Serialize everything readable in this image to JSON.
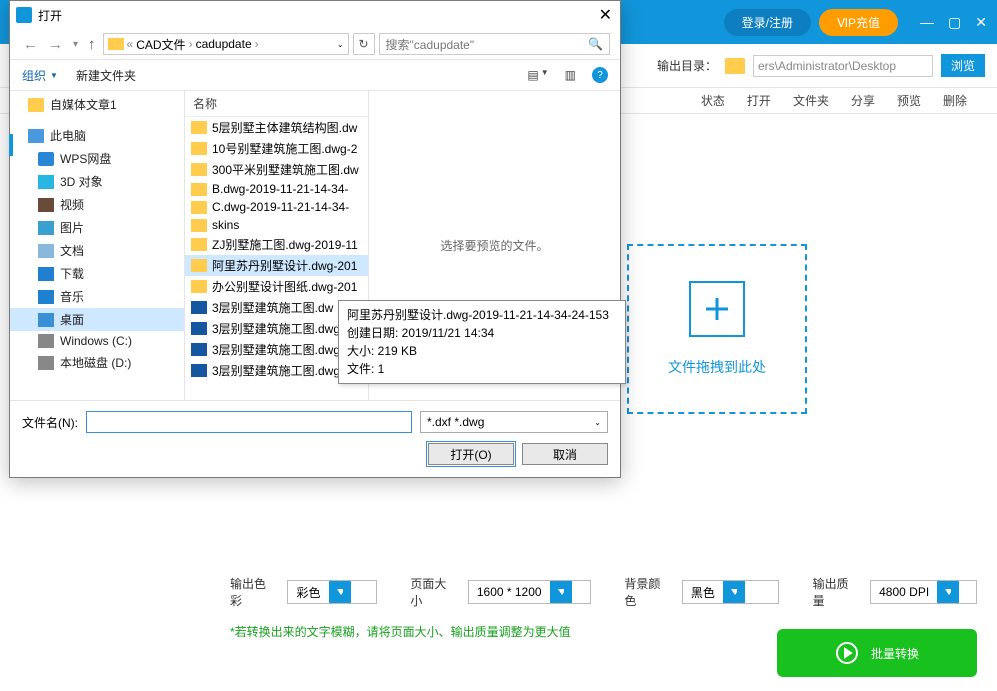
{
  "app": {
    "login": "登录/注册",
    "vip": "ⅥP充值",
    "outdir_label": "输出目录：",
    "outdir_path": "ers\\Administrator\\Desktop",
    "browse": "浏览",
    "cols": {
      "status": "状态",
      "open": "打开",
      "folder": "文件夹",
      "share": "分享",
      "preview": "预览",
      "delete": "删除"
    },
    "drop_text": "文件拖拽到此处",
    "footer": {
      "colorspace_label": "输出色彩",
      "colorspace_value": "彩色",
      "pagesize_label": "页面大小",
      "pagesize_value": "1600 * 1200",
      "bgcolor_label": "背景颜色",
      "bgcolor_value": "黑色",
      "quality_label": "输出质量",
      "quality_value": "4800 DPI",
      "hint": "*若转换出来的文字模糊，请将页面大小、输出质量调整为更大值",
      "convert": "批量转换"
    }
  },
  "dialog": {
    "title": "打开",
    "crumbs": [
      "CAD文件",
      "cadupdate"
    ],
    "search_placeholder": "搜索\"cadupdate\"",
    "organize": "组织",
    "new_folder": "新建文件夹",
    "tree": {
      "media": "自媒体文章1",
      "pc": "此电脑",
      "items": [
        {
          "icon": "wps",
          "label": "WPS网盘"
        },
        {
          "icon": "cube",
          "label": "3D 对象"
        },
        {
          "icon": "vid",
          "label": "视频"
        },
        {
          "icon": "img",
          "label": "图片"
        },
        {
          "icon": "doc",
          "label": "文档"
        },
        {
          "icon": "dl",
          "label": "下载"
        },
        {
          "icon": "music",
          "label": "音乐"
        },
        {
          "icon": "desk",
          "label": "桌面"
        },
        {
          "icon": "hdd",
          "label": "Windows (C:)"
        },
        {
          "icon": "hdd",
          "label": "本地磁盘 (D:)"
        }
      ]
    },
    "file_header": "名称",
    "files": [
      {
        "type": "folder",
        "name": "5层别墅主体建筑结构图.dw"
      },
      {
        "type": "folder",
        "name": "10号别墅建筑施工图.dwg-2"
      },
      {
        "type": "folder",
        "name": "300平米别墅建筑施工图.dw"
      },
      {
        "type": "folder",
        "name": "B.dwg-2019-11-21-14-34-"
      },
      {
        "type": "folder",
        "name": "C.dwg-2019-11-21-14-34-"
      },
      {
        "type": "folder",
        "name": "skins"
      },
      {
        "type": "folder",
        "name": "ZJ别墅施工图.dwg-2019-11"
      },
      {
        "type": "folder",
        "name": "阿里苏丹别墅设计.dwg-201",
        "selected": true
      },
      {
        "type": "folder",
        "name": "办公别墅设计图纸.dwg-201"
      },
      {
        "type": "cad",
        "name": "3层别墅建筑施工图.dw"
      },
      {
        "type": "cad",
        "name": "3层别墅建筑施工图.dwg-20"
      },
      {
        "type": "cad",
        "name": "3层别墅建筑施工图.dwg-20"
      },
      {
        "type": "cad",
        "name": "3层别墅建筑施工图.dwg-20"
      }
    ],
    "preview_text": "选择要预览的文件。",
    "filename_label": "文件名(N):",
    "filetype": "*.dxf *.dwg",
    "open_btn": "打开(O)",
    "cancel_btn": "取消"
  },
  "tooltip": {
    "name": "阿里苏丹别墅设计.dwg-2019-11-21-14-34-24-153",
    "created_label": "创建日期: ",
    "created": "2019/11/21 14:34",
    "size_label": "大小: ",
    "size": "219 KB",
    "files_label": "文件: ",
    "files": "1"
  }
}
